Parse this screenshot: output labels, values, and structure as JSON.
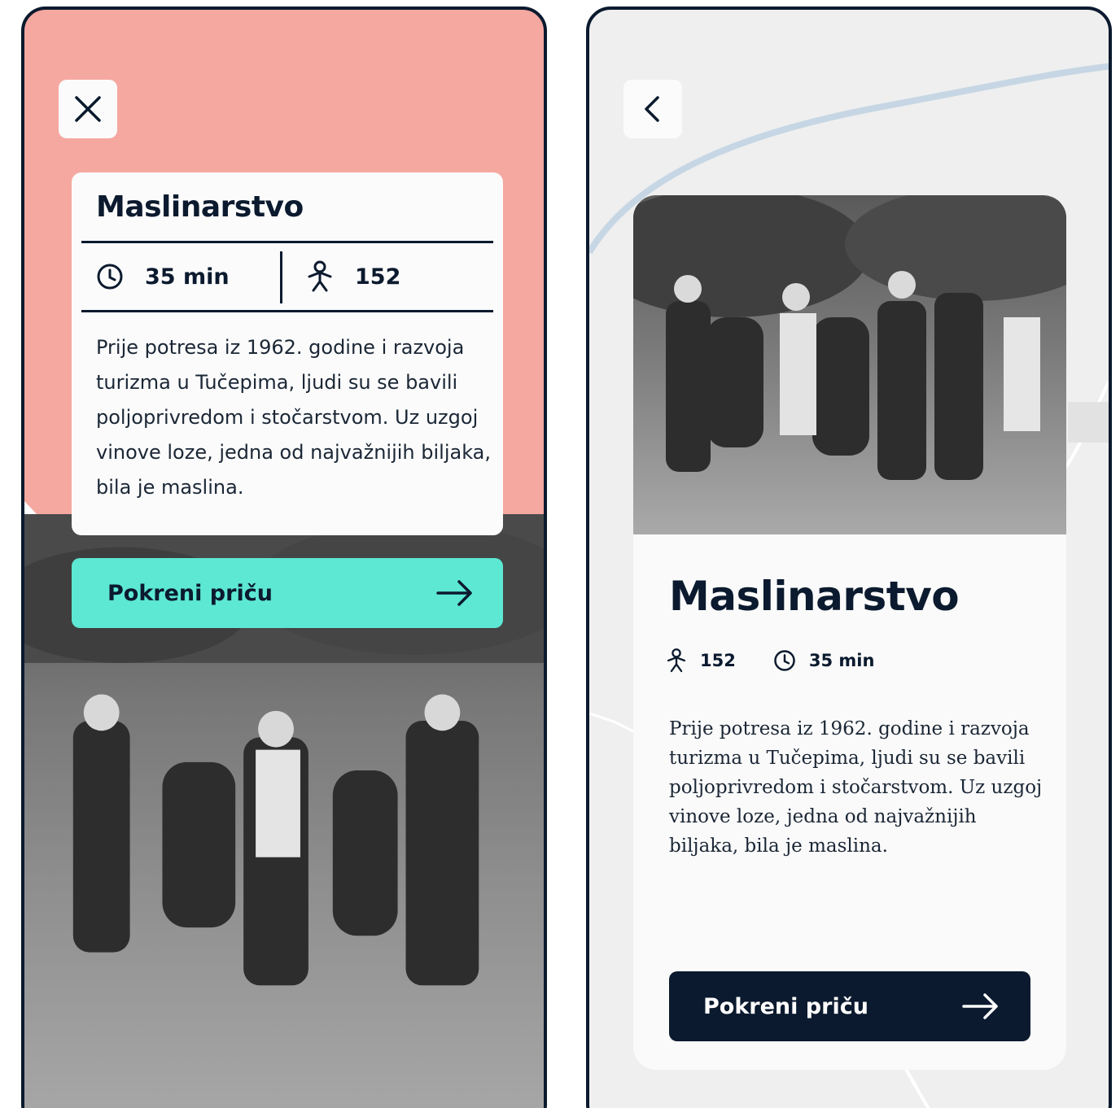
{
  "left_screen": {
    "close_button": {
      "icon": "close-icon"
    },
    "card": {
      "title": "Maslinarstvo",
      "duration": "35 min",
      "visits": "152",
      "description": "Prije potresa iz 1962. godine i razvoja turizma u Tučepima, ljudi su se bavili poljoprivredom i stočarstvom. Uz uzgoj vinove loze, jedna od najvažnijih biljaka, bila je maslina."
    },
    "cta": {
      "label": "Pokreni priču",
      "icon": "arrow-right-icon"
    },
    "colors": {
      "background": "#f5a8a0",
      "cta": "#5de8d4"
    }
  },
  "right_screen": {
    "back_button": {
      "icon": "chevron-left-icon"
    },
    "card": {
      "title": "Maslinarstvo",
      "visits": "152",
      "duration": "35 min",
      "description": "Prije potresa iz 1962. godine i razvoja turizma u Tučepima, ljudi su se bavili poljoprivredom i stočarstvom. Uz uzgoj vinove loze, jedna od najvažnijih biljaka, bila je maslina."
    },
    "cta": {
      "label": "Pokreni priču",
      "icon": "arrow-right-icon"
    },
    "colors": {
      "background": "#efefef",
      "cta": "#0b1a2e"
    }
  }
}
